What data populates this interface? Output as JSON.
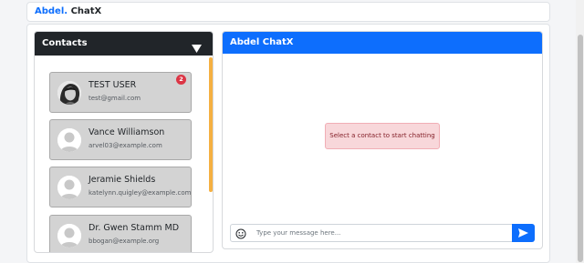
{
  "brand": {
    "part1": "Abdel.",
    "part2": "ChatX"
  },
  "contacts": {
    "title": "Contacts",
    "toggle_icon": "triangle-down-icon",
    "items": [
      {
        "name": "TEST USER",
        "email": "test@gmail.com",
        "badge": "2",
        "avatar": "photo-avatar"
      },
      {
        "name": "Vance Williamson",
        "email": "arvel03@example.com",
        "avatar": "default-avatar"
      },
      {
        "name": "Jeramie Shields",
        "email": "katelynn.quigley@example.com",
        "avatar": "default-avatar"
      },
      {
        "name": "Dr. Gwen Stamm MD",
        "email": "bbogan@example.org",
        "avatar": "default-avatar"
      }
    ]
  },
  "chat": {
    "title": "Abdel ChatX",
    "empty_message": "Select a contact to start chatting",
    "input_placeholder": "Type your message here...",
    "emoji_icon": "smiley-icon",
    "send_icon": "send-icon"
  },
  "colors": {
    "primary": "#0d6efd",
    "dark_header": "#212529",
    "badge": "#dc3545",
    "alert_bg": "#f8d7da",
    "alert_text": "#842029",
    "contact_card_bg": "#d3d3d3",
    "contacts_scroll_thumb": "#f5b041"
  }
}
